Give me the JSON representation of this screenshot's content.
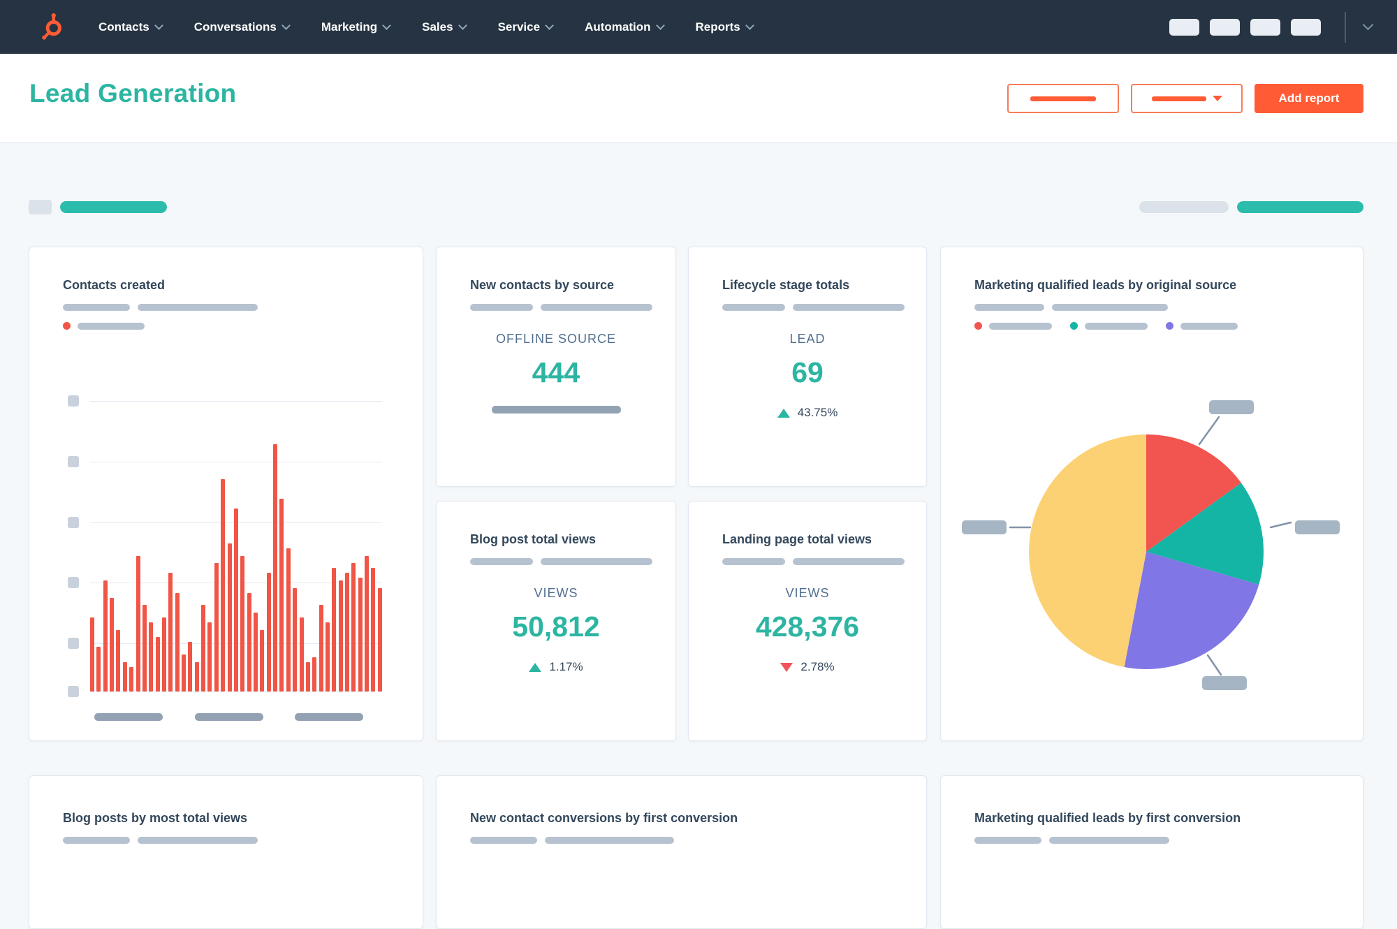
{
  "nav": {
    "items": [
      {
        "label": "Contacts"
      },
      {
        "label": "Conversations"
      },
      {
        "label": "Marketing"
      },
      {
        "label": "Sales"
      },
      {
        "label": "Service"
      },
      {
        "label": "Automation"
      },
      {
        "label": "Reports"
      }
    ]
  },
  "header": {
    "title": "Lead Generation",
    "buttons": {
      "add_report": "Add report"
    }
  },
  "cards": {
    "contacts_created": {
      "title": "Contacts created"
    },
    "new_contacts_by_source": {
      "title": "New contacts by source",
      "metric_label": "OFFLINE SOURCE",
      "value": "444"
    },
    "lifecycle_stage_totals": {
      "title": "Lifecycle stage totals",
      "metric_label": "LEAD",
      "value": "69",
      "delta": "43.75%",
      "delta_direction": "up"
    },
    "mql_by_original_source": {
      "title": "Marketing qualified leads by original source"
    },
    "blog_post_total_views": {
      "title": "Blog post total views",
      "metric_label": "VIEWS",
      "value": "50,812",
      "delta": "1.17%",
      "delta_direction": "up"
    },
    "landing_page_total_views": {
      "title": "Landing page total views",
      "metric_label": "VIEWS",
      "value": "428,376",
      "delta": "2.78%",
      "delta_direction": "down"
    },
    "blog_posts_by_most_total_views": {
      "title": "Blog posts by most total views"
    },
    "new_contact_conversions_by_first_conversion": {
      "title": "New contact conversions by first conversion"
    },
    "mql_by_first_conversion": {
      "title": "Marketing qualified leads by first conversion"
    }
  },
  "colors": {
    "navy": "#253342",
    "teal": "#2cb5a2",
    "teal_pill": "#2cbcac",
    "orange": "#ff5c35",
    "bar_orange": "#f05546",
    "red": "#f2545b"
  },
  "chart_data": [
    {
      "type": "bar",
      "title": "Contacts created",
      "axis_labels_redacted": true,
      "values_pct_of_max": [
        30,
        18,
        45,
        38,
        25,
        12,
        10,
        55,
        35,
        28,
        22,
        30,
        48,
        40,
        15,
        20,
        12,
        35,
        28,
        52,
        86,
        60,
        74,
        55,
        40,
        32,
        25,
        48,
        100,
        78,
        58,
        42,
        30,
        12,
        14,
        35,
        28,
        50,
        45,
        48,
        52,
        46,
        55,
        50,
        42
      ],
      "bar_color": "#f05546"
    },
    {
      "type": "pie",
      "title": "Marketing qualified leads by original source",
      "legend_labels_redacted": true,
      "slices": [
        {
          "label": "",
          "value": 15,
          "color": "#f25450"
        },
        {
          "label": "",
          "value": 14.5,
          "color": "#14b5a5"
        },
        {
          "label": "",
          "value": 23.5,
          "color": "#8176e5"
        },
        {
          "label": "",
          "value": 47,
          "color": "#fcd173"
        }
      ]
    }
  ]
}
